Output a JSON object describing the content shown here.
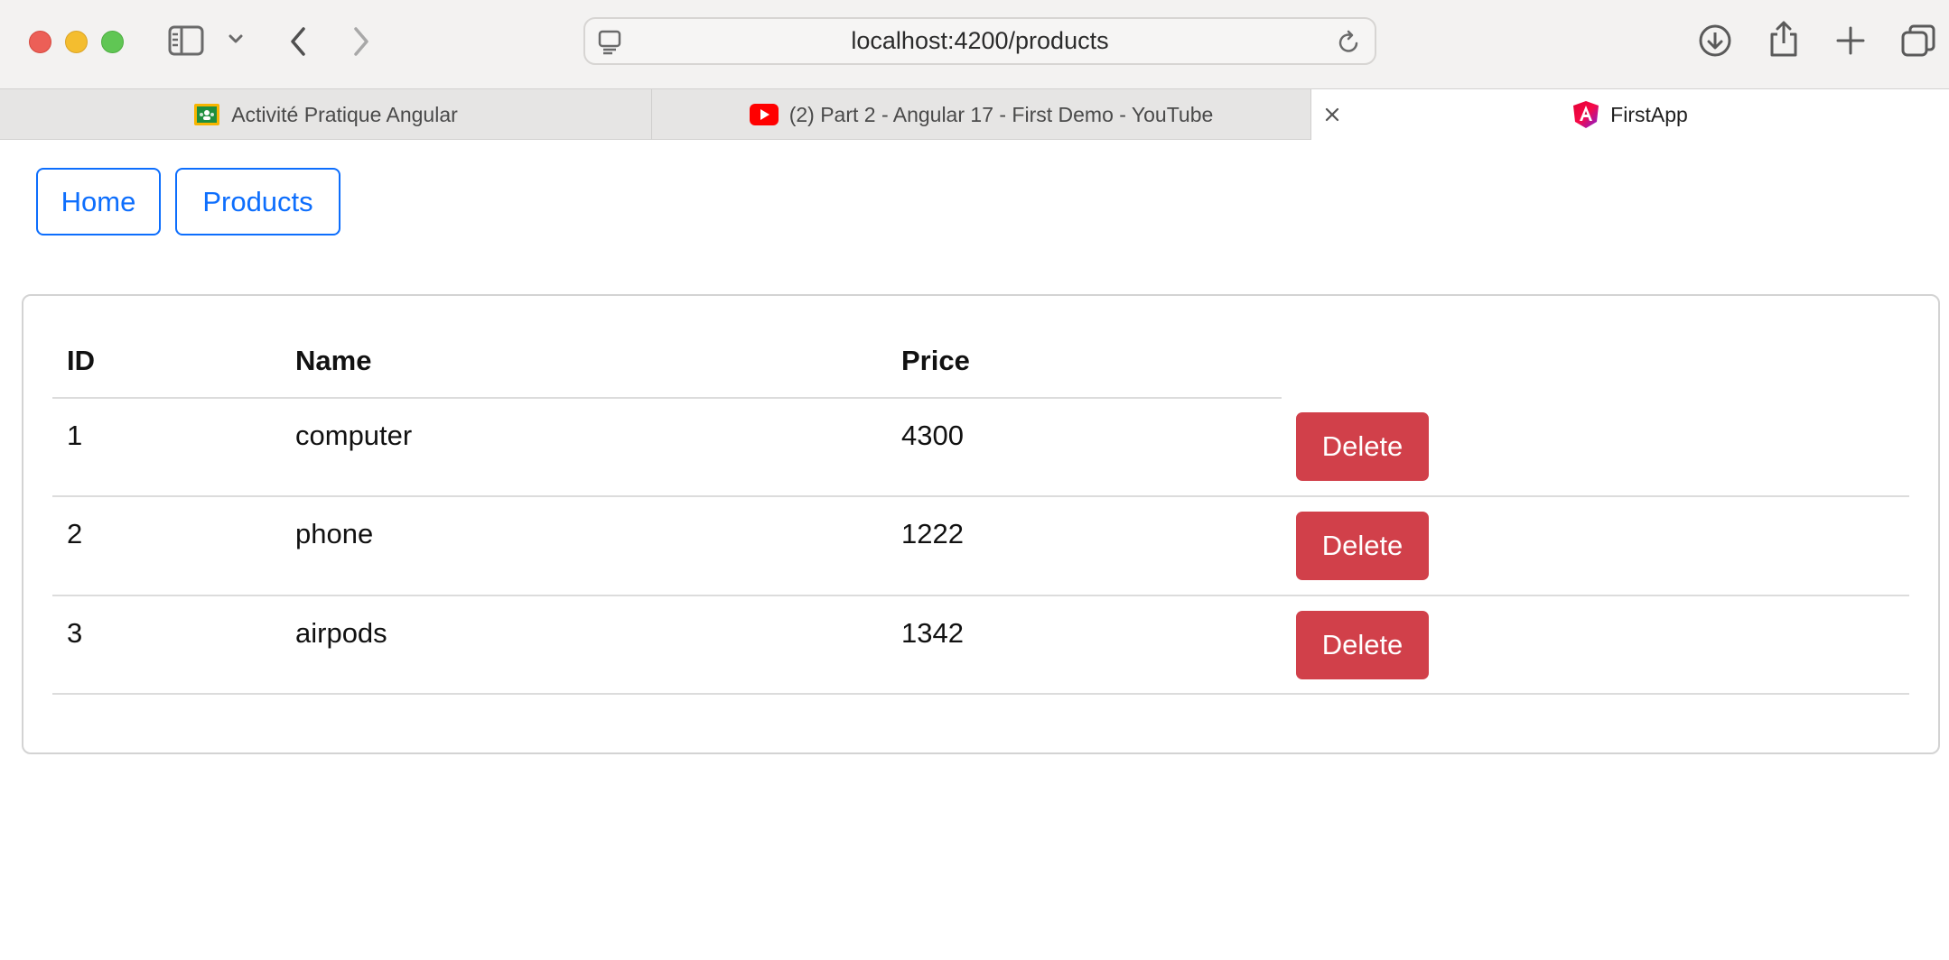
{
  "browser": {
    "url": "localhost:4200/products",
    "tabs": [
      {
        "label": "Activité Pratique Angular"
      },
      {
        "label": "(2) Part 2 - Angular 17 - First Demo - YouTube"
      },
      {
        "label": "FirstApp"
      }
    ]
  },
  "nav": {
    "home_label": "Home",
    "products_label": "Products"
  },
  "table": {
    "headers": {
      "id": "ID",
      "name": "Name",
      "price": "Price"
    },
    "rows": [
      {
        "id": "1",
        "name": "computer",
        "price": "4300",
        "action": "Delete"
      },
      {
        "id": "2",
        "name": "phone",
        "price": "1222",
        "action": "Delete"
      },
      {
        "id": "3",
        "name": "airpods",
        "price": "1342",
        "action": "Delete"
      }
    ]
  },
  "colors": {
    "primary": "#0d6efd",
    "danger": "#d1404a"
  },
  "icons": {
    "toolbar": [
      "sidebar-icon",
      "chevron-down-icon",
      "back-icon",
      "forward-icon",
      "download-icon",
      "share-icon",
      "new-tab-icon",
      "tab-overview-icon"
    ],
    "address": [
      "page-menu-icon",
      "reload-icon"
    ],
    "tabs": [
      "google-classroom-favicon",
      "youtube-favicon",
      "close-icon",
      "angular-favicon"
    ]
  }
}
